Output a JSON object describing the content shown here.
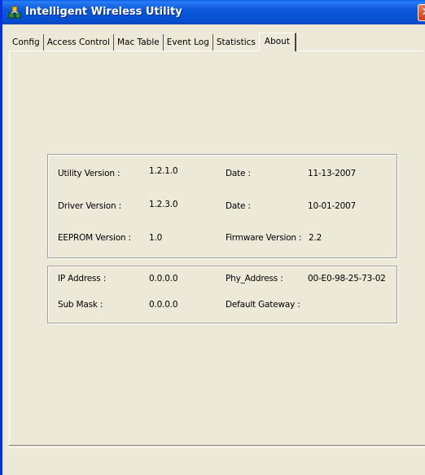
{
  "window": {
    "title": "Intelligent Wireless Utility",
    "close_glyph": "✕",
    "titlebar_color": "#0a58d8",
    "icon": "wireless-network-icon"
  },
  "tabs": [
    {
      "label": "Config"
    },
    {
      "label": "Access Control"
    },
    {
      "label": "Mac Table"
    },
    {
      "label": "Event Log"
    },
    {
      "label": "Statistics"
    },
    {
      "label": "About",
      "active": true
    }
  ],
  "version_info": {
    "utility_version_label": "Utility Version :",
    "utility_version": "1.2.1.0",
    "utility_date_label": "Date :",
    "utility_date": "11-13-2007",
    "driver_version_label": "Driver Version :",
    "driver_version": "1.2.3.0",
    "driver_date_label": "Date :",
    "driver_date": "10-01-2007",
    "eeprom_version_label": "EEPROM Version :",
    "eeprom_version": "1.0",
    "firmware_version_label": "Firmware Version :",
    "firmware_version": "2.2"
  },
  "network_info": {
    "ip_address_label": "IP Address :",
    "ip_address": "0.0.0.0",
    "phy_address_label": "Phy_Address :",
    "phy_address": "00-E0-98-25-73-02",
    "sub_mask_label": "Sub Mask :",
    "sub_mask": "0.0.0.0",
    "default_gateway_label": "Default Gateway :",
    "default_gateway": ""
  }
}
